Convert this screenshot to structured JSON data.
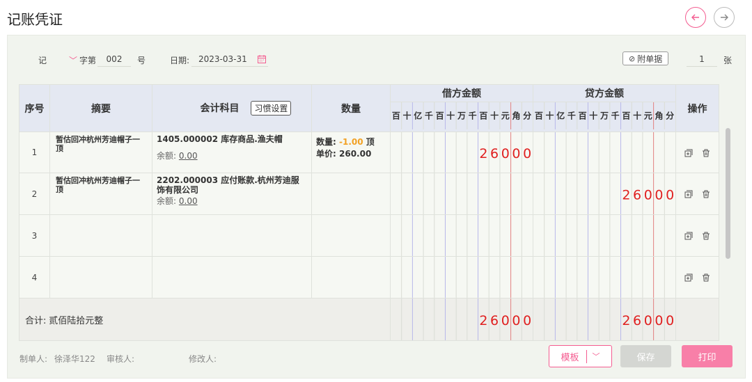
{
  "page": {
    "title": "记账凭证"
  },
  "header": {
    "voucher_word": "记",
    "word_suffix": "字第",
    "number": "002",
    "number_suffix": "号",
    "date_label": "日期:",
    "date_value": "2023-03-31",
    "attach_label": "附单据",
    "attach_count": "1",
    "attach_unit": "张"
  },
  "table": {
    "col_seq": "序号",
    "col_summary": "摘要",
    "col_account": "会计科目",
    "habit_btn": "习惯设置",
    "col_qty": "数量",
    "col_debit": "借方金额",
    "col_credit": "贷方金额",
    "col_ops": "操作",
    "digit_labels": [
      "百",
      "十",
      "亿",
      "千",
      "百",
      "十",
      "万",
      "千",
      "百",
      "十",
      "元",
      "角",
      "分"
    ],
    "rows": [
      {
        "seq": "1",
        "summary": "暂估回冲杭州芳迪帽子一顶",
        "account": "1405.000002 库存商品.渔夫帽",
        "balance_label": "余额:",
        "balance": "0.00",
        "qty_label": "数量:",
        "qty_value": "-1.00",
        "qty_unit": "顶",
        "price_label": "单价:",
        "price_value": "260.00",
        "debit": "26000",
        "credit": ""
      },
      {
        "seq": "2",
        "summary": "暂估回冲杭州芳迪帽子一顶",
        "account": "2202.000003 应付账款.杭州芳迪服饰有限公司",
        "balance_label": "余额:",
        "balance": "0.00",
        "qty_label": "",
        "qty_value": "",
        "qty_unit": "",
        "price_label": "",
        "price_value": "",
        "debit": "",
        "credit": "26000"
      },
      {
        "seq": "3",
        "summary": "",
        "account": "",
        "debit": "",
        "credit": ""
      },
      {
        "seq": "4",
        "summary": "",
        "account": "",
        "debit": "",
        "credit": ""
      }
    ],
    "total_label": "合计:",
    "total_words": "贰佰陆拾元整",
    "total_debit": "26000",
    "total_credit": "26000"
  },
  "footer": {
    "maker_label": "制单人:",
    "maker": "徐泽华122",
    "reviewer_label": "审核人:",
    "reviewer": "",
    "modifier_label": "修改人:",
    "modifier": "",
    "template_btn": "模板",
    "save_btn": "保存",
    "print_btn": "打印"
  },
  "colors": {
    "accent": "#f45c90",
    "amount": "#e02020",
    "header_bg": "#e4e8f2",
    "panel_bg": "#f1f4ee"
  }
}
